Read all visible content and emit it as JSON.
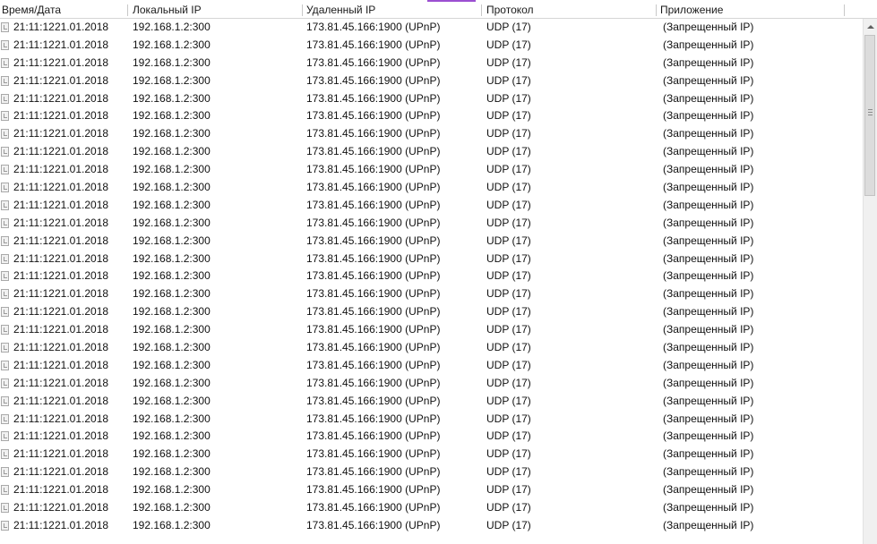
{
  "columns": [
    {
      "key": "time",
      "label": "Время/Дата"
    },
    {
      "key": "local",
      "label": "Локальный IP"
    },
    {
      "key": "remote",
      "label": "Удаленный IP"
    },
    {
      "key": "protocol",
      "label": "Протокол"
    },
    {
      "key": "app",
      "label": "Приложение"
    }
  ],
  "rows": [
    {
      "time": "21:11:12",
      "date": "21.01.2018",
      "local": "192.168.1.2:300",
      "remote": "173.81.45.166:1900 (UPnP)",
      "protocol": "UDP (17)",
      "app": "(Запрещенный IP)"
    },
    {
      "time": "21:11:12",
      "date": "21.01.2018",
      "local": "192.168.1.2:300",
      "remote": "173.81.45.166:1900 (UPnP)",
      "protocol": "UDP (17)",
      "app": "(Запрещенный IP)"
    },
    {
      "time": "21:11:12",
      "date": "21.01.2018",
      "local": "192.168.1.2:300",
      "remote": "173.81.45.166:1900 (UPnP)",
      "protocol": "UDP (17)",
      "app": "(Запрещенный IP)"
    },
    {
      "time": "21:11:12",
      "date": "21.01.2018",
      "local": "192.168.1.2:300",
      "remote": "173.81.45.166:1900 (UPnP)",
      "protocol": "UDP (17)",
      "app": "(Запрещенный IP)"
    },
    {
      "time": "21:11:12",
      "date": "21.01.2018",
      "local": "192.168.1.2:300",
      "remote": "173.81.45.166:1900 (UPnP)",
      "protocol": "UDP (17)",
      "app": "(Запрещенный IP)"
    },
    {
      "time": "21:11:12",
      "date": "21.01.2018",
      "local": "192.168.1.2:300",
      "remote": "173.81.45.166:1900 (UPnP)",
      "protocol": "UDP (17)",
      "app": "(Запрещенный IP)"
    },
    {
      "time": "21:11:12",
      "date": "21.01.2018",
      "local": "192.168.1.2:300",
      "remote": "173.81.45.166:1900 (UPnP)",
      "protocol": "UDP (17)",
      "app": "(Запрещенный IP)"
    },
    {
      "time": "21:11:12",
      "date": "21.01.2018",
      "local": "192.168.1.2:300",
      "remote": "173.81.45.166:1900 (UPnP)",
      "protocol": "UDP (17)",
      "app": "(Запрещенный IP)"
    },
    {
      "time": "21:11:12",
      "date": "21.01.2018",
      "local": "192.168.1.2:300",
      "remote": "173.81.45.166:1900 (UPnP)",
      "protocol": "UDP (17)",
      "app": "(Запрещенный IP)"
    },
    {
      "time": "21:11:12",
      "date": "21.01.2018",
      "local": "192.168.1.2:300",
      "remote": "173.81.45.166:1900 (UPnP)",
      "protocol": "UDP (17)",
      "app": "(Запрещенный IP)"
    },
    {
      "time": "21:11:12",
      "date": "21.01.2018",
      "local": "192.168.1.2:300",
      "remote": "173.81.45.166:1900 (UPnP)",
      "protocol": "UDP (17)",
      "app": "(Запрещенный IP)"
    },
    {
      "time": "21:11:12",
      "date": "21.01.2018",
      "local": "192.168.1.2:300",
      "remote": "173.81.45.166:1900 (UPnP)",
      "protocol": "UDP (17)",
      "app": "(Запрещенный IP)"
    },
    {
      "time": "21:11:12",
      "date": "21.01.2018",
      "local": "192.168.1.2:300",
      "remote": "173.81.45.166:1900 (UPnP)",
      "protocol": "UDP (17)",
      "app": "(Запрещенный IP)"
    },
    {
      "time": "21:11:12",
      "date": "21.01.2018",
      "local": "192.168.1.2:300",
      "remote": "173.81.45.166:1900 (UPnP)",
      "protocol": "UDP (17)",
      "app": "(Запрещенный IP)"
    },
    {
      "time": "21:11:12",
      "date": "21.01.2018",
      "local": "192.168.1.2:300",
      "remote": "173.81.45.166:1900 (UPnP)",
      "protocol": "UDP (17)",
      "app": "(Запрещенный IP)"
    },
    {
      "time": "21:11:12",
      "date": "21.01.2018",
      "local": "192.168.1.2:300",
      "remote": "173.81.45.166:1900 (UPnP)",
      "protocol": "UDP (17)",
      "app": "(Запрещенный IP)"
    },
    {
      "time": "21:11:12",
      "date": "21.01.2018",
      "local": "192.168.1.2:300",
      "remote": "173.81.45.166:1900 (UPnP)",
      "protocol": "UDP (17)",
      "app": "(Запрещенный IP)"
    },
    {
      "time": "21:11:12",
      "date": "21.01.2018",
      "local": "192.168.1.2:300",
      "remote": "173.81.45.166:1900 (UPnP)",
      "protocol": "UDP (17)",
      "app": "(Запрещенный IP)"
    },
    {
      "time": "21:11:12",
      "date": "21.01.2018",
      "local": "192.168.1.2:300",
      "remote": "173.81.45.166:1900 (UPnP)",
      "protocol": "UDP (17)",
      "app": "(Запрещенный IP)"
    },
    {
      "time": "21:11:12",
      "date": "21.01.2018",
      "local": "192.168.1.2:300",
      "remote": "173.81.45.166:1900 (UPnP)",
      "protocol": "UDP (17)",
      "app": "(Запрещенный IP)"
    },
    {
      "time": "21:11:12",
      "date": "21.01.2018",
      "local": "192.168.1.2:300",
      "remote": "173.81.45.166:1900 (UPnP)",
      "protocol": "UDP (17)",
      "app": "(Запрещенный IP)"
    },
    {
      "time": "21:11:12",
      "date": "21.01.2018",
      "local": "192.168.1.2:300",
      "remote": "173.81.45.166:1900 (UPnP)",
      "protocol": "UDP (17)",
      "app": "(Запрещенный IP)"
    },
    {
      "time": "21:11:12",
      "date": "21.01.2018",
      "local": "192.168.1.2:300",
      "remote": "173.81.45.166:1900 (UPnP)",
      "protocol": "UDP (17)",
      "app": "(Запрещенный IP)"
    },
    {
      "time": "21:11:12",
      "date": "21.01.2018",
      "local": "192.168.1.2:300",
      "remote": "173.81.45.166:1900 (UPnP)",
      "protocol": "UDP (17)",
      "app": "(Запрещенный IP)"
    },
    {
      "time": "21:11:12",
      "date": "21.01.2018",
      "local": "192.168.1.2:300",
      "remote": "173.81.45.166:1900 (UPnP)",
      "protocol": "UDP (17)",
      "app": "(Запрещенный IP)"
    },
    {
      "time": "21:11:12",
      "date": "21.01.2018",
      "local": "192.168.1.2:300",
      "remote": "173.81.45.166:1900 (UPnP)",
      "protocol": "UDP (17)",
      "app": "(Запрещенный IP)"
    },
    {
      "time": "21:11:12",
      "date": "21.01.2018",
      "local": "192.168.1.2:300",
      "remote": "173.81.45.166:1900 (UPnP)",
      "protocol": "UDP (17)",
      "app": "(Запрещенный IP)"
    },
    {
      "time": "21:11:12",
      "date": "21.01.2018",
      "local": "192.168.1.2:300",
      "remote": "173.81.45.166:1900 (UPnP)",
      "protocol": "UDP (17)",
      "app": "(Запрещенный IP)"
    },
    {
      "time": "21:11:12",
      "date": "21.01.2018",
      "local": "192.168.1.2:300",
      "remote": "173.81.45.166:1900 (UPnP)",
      "protocol": "UDP (17)",
      "app": "(Запрещенный IP)"
    }
  ],
  "icons": {
    "row": "connection-entry-icon",
    "scroll_up": "scroll-up-arrow-icon"
  },
  "colors": {
    "accent": "#9b4fd1"
  }
}
